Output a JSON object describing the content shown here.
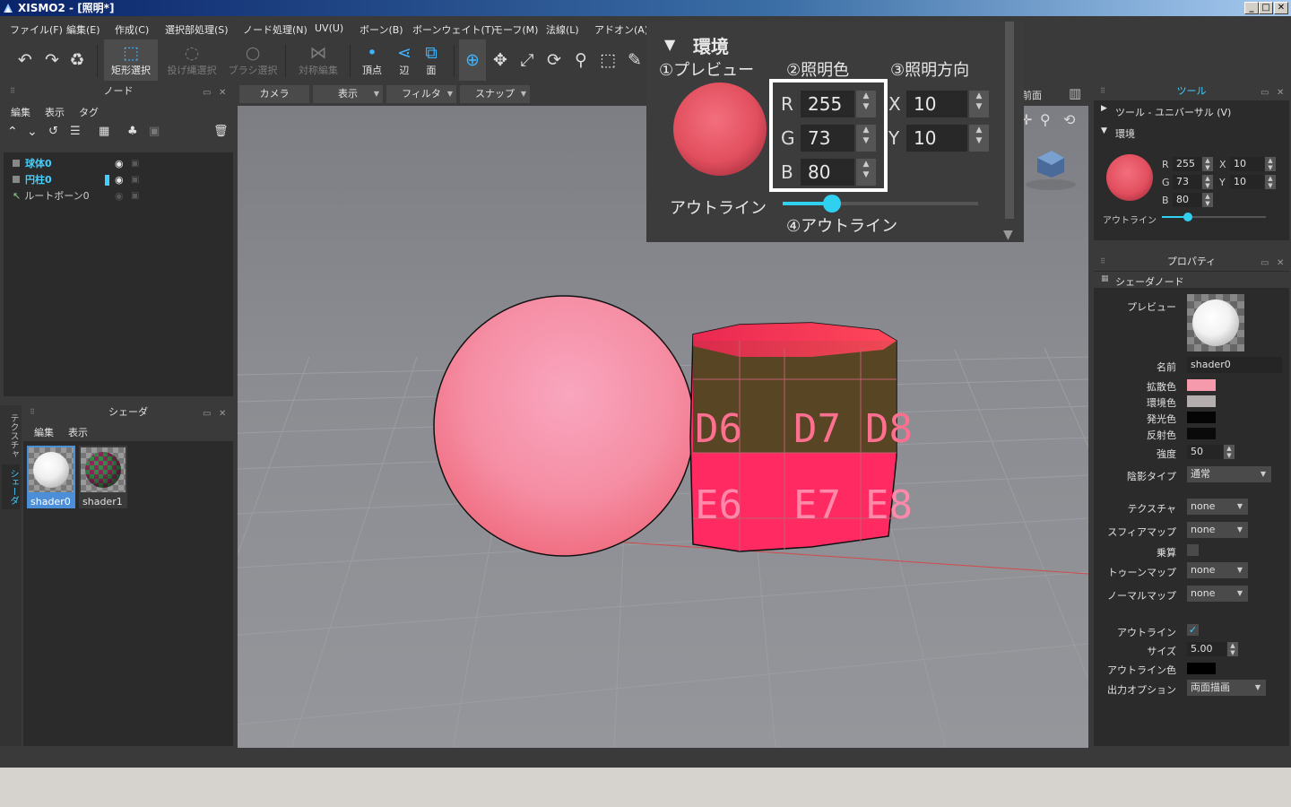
{
  "window": {
    "title": "XISMO2 - [照明*]",
    "min": "_",
    "max": "□",
    "close": "✕"
  },
  "menu": [
    "ファイル(F)",
    "編集(E)",
    "作成(C)",
    "選択部処理(S)",
    "ノード処理(N)",
    "UV(U)",
    "ボーン(B)",
    "ボーンウェイト(T)",
    "モーフ(M)",
    "法線(L)",
    "アドオン(A)"
  ],
  "toolbar": {
    "rect_select": "矩形選択",
    "lasso_select": "投げ縄選択",
    "brush_select": "ブラシ選択",
    "sym_edit": "対称編集",
    "vertex": "頂点",
    "edge": "辺",
    "face": "面"
  },
  "node_panel": {
    "title": "ノード",
    "tabs": [
      "編集",
      "表示",
      "タグ"
    ],
    "items": [
      {
        "label": "球体0"
      },
      {
        "label": "円柱0"
      },
      {
        "label": "ルートボーン0"
      }
    ]
  },
  "shader_panel": {
    "title": "シェーダ",
    "tabs": [
      "編集",
      "表示"
    ],
    "items": [
      {
        "label": "shader0"
      },
      {
        "label": "shader1"
      }
    ]
  },
  "side_tabs": {
    "texture": "テクスチャ",
    "shader": "シェーダ"
  },
  "viewport": {
    "tabs": [
      "カメラ",
      "表示",
      "フィルタ",
      "スナップ"
    ],
    "front_label": "前面",
    "cyl_labels": [
      "D6",
      "D7",
      "D8",
      "E6",
      "E7",
      "E8"
    ]
  },
  "env_overlay": {
    "title": "環境",
    "label_preview": "①プレビュー",
    "label_color": "②照明色",
    "label_dir": "③照明方向",
    "label_outline": "④アウトライン",
    "outline": "アウトライン",
    "r_label": "R",
    "g_label": "G",
    "b_label": "B",
    "x_label": "X",
    "y_label": "Y",
    "r": "255",
    "g": "73",
    "b": "80",
    "x": "10",
    "y": "10",
    "outline_level": 0.25
  },
  "tool_panel": {
    "title": "ツール",
    "universal": "ツール - ユニバーサル (V)",
    "env": "環境",
    "r_label": "R",
    "g_label": "G",
    "b_label": "B",
    "x_label": "X",
    "y_label": "Y",
    "r": "255",
    "g": "73",
    "b": "80",
    "x": "10",
    "y": "10",
    "outline": "アウトライン",
    "outline_level": 0.25
  },
  "props": {
    "title": "プロパティ",
    "section": "シェーダノード",
    "preview": "プレビュー",
    "name_label": "名前",
    "name": "shader0",
    "diffuse": "拡散色",
    "ambient": "環境色",
    "emissive": "発光色",
    "specular": "反射色",
    "strength_label": "強度",
    "strength": "50",
    "shade_type_label": "陰影タイプ",
    "shade_type": "通常",
    "texture_label": "テクスチャ",
    "texture": "none",
    "sphere_label": "スフィアマップ",
    "sphere": "none",
    "multiply_label": "乗算",
    "toon_label": "トゥーンマップ",
    "toon": "none",
    "normal_label": "ノーマルマップ",
    "normal": "none",
    "outline_label": "アウトライン",
    "size_label": "サイズ",
    "size": "5.00",
    "outline_color_label": "アウトライン色",
    "output_label": "出力オプション",
    "output": "両面描画"
  },
  "colors": {
    "accent": "#3fb4ff",
    "diffuse": "#f59aad",
    "ambient": "#b4aeae",
    "emissive": "#050505",
    "specular": "#0a0a0a",
    "outline_color": "#000000"
  }
}
